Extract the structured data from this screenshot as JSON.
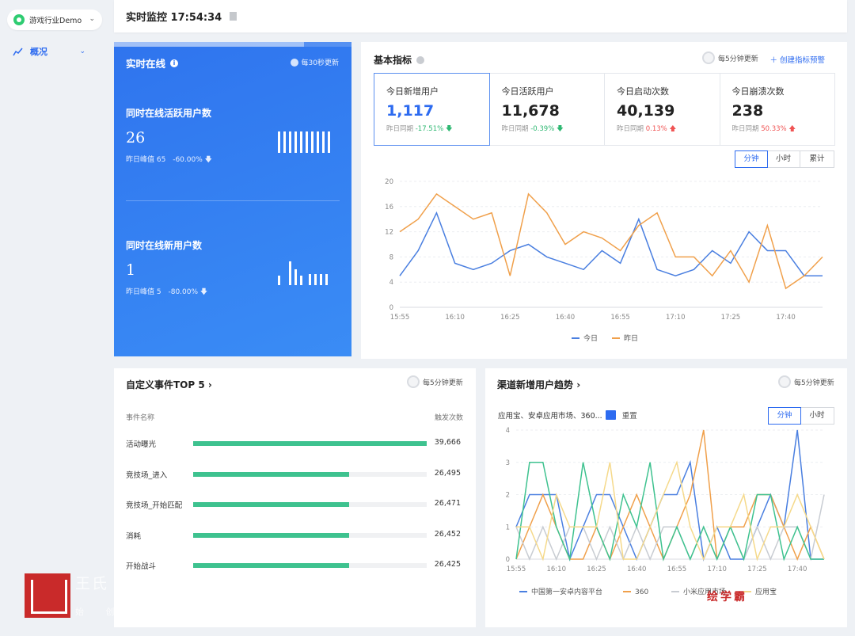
{
  "sidebar": {
    "app_name": "游戏行业Demo",
    "nav": [
      {
        "label": "概况"
      }
    ]
  },
  "topbar": {
    "title": "实时监控 17:54:34"
  },
  "online_panel": {
    "title": "实时在线",
    "refresh": "每30秒更新",
    "progress_fraction": 0.8,
    "active": {
      "label": "同时在线活跃用户数",
      "value": "26",
      "peak": "昨日峰值 65",
      "change": "-60.00%"
    },
    "new": {
      "label": "同时在线新用户数",
      "value": "1",
      "peak": "昨日峰值 5",
      "change": "-80.00%"
    }
  },
  "basic_metrics": {
    "title": "基本指标",
    "refresh": "每5分钟更新",
    "create_alert": "创建指标预警",
    "compare_label": "昨日同期",
    "kpis": [
      {
        "name": "今日新增用户",
        "value": "1,117",
        "change": "-17.51%",
        "dir": "down"
      },
      {
        "name": "今日活跃用户",
        "value": "11,678",
        "change": "-0.39%",
        "dir": "down"
      },
      {
        "name": "今日启动次数",
        "value": "40,139",
        "change": "0.13%",
        "dir": "up"
      },
      {
        "name": "今日崩溃次数",
        "value": "238",
        "change": "50.33%",
        "dir": "up"
      }
    ],
    "granularity": [
      "分钟",
      "小时",
      "累计"
    ],
    "granularity_selected": 0
  },
  "top_events": {
    "title": "自定义事件TOP 5",
    "refresh": "每5分钟更新",
    "col_name": "事件名称",
    "col_count": "触发次数",
    "max": 39666,
    "rows": [
      {
        "name": "活动曝光",
        "count": "39,666",
        "value": 39666
      },
      {
        "name": "竞技场_进入",
        "count": "26,495",
        "value": 26495
      },
      {
        "name": "竞技场_开始匹配",
        "count": "26,471",
        "value": 26471
      },
      {
        "name": "消耗",
        "count": "26,452",
        "value": 26452
      },
      {
        "name": "开始战斗",
        "count": "26,425",
        "value": 26425
      }
    ]
  },
  "channel_trend": {
    "title": "渠道新增用户趋势",
    "refresh": "每5分钟更新",
    "selector": "应用宝、安卓应用市场、360...",
    "reset": "重置",
    "granularity": [
      "分钟",
      "小时"
    ],
    "granularity_selected": 0
  },
  "watermark": {
    "text1": "王氏",
    "text2": "始 创",
    "text3": "绘学霸"
  },
  "chart_data": [
    {
      "type": "line",
      "x": [
        "15:55",
        "16:00",
        "16:05",
        "16:10",
        "16:15",
        "16:20",
        "16:25",
        "16:30",
        "16:35",
        "16:40",
        "16:45",
        "16:50",
        "16:55",
        "17:00",
        "17:05",
        "17:10",
        "17:15",
        "17:20",
        "17:25",
        "17:30",
        "17:35",
        "17:40",
        "17:45",
        "17:50"
      ],
      "x_ticks": [
        "15:55",
        "16:10",
        "16:25",
        "16:40",
        "16:55",
        "17:10",
        "17:25",
        "17:40"
      ],
      "ylim": [
        0,
        20
      ],
      "y_ticks": [
        0,
        4,
        8,
        12,
        16,
        20
      ],
      "grid": true,
      "legend": "bottom",
      "series": [
        {
          "name": "今日",
          "color": "#4a7fe0",
          "values": [
            5,
            9,
            15,
            7,
            6,
            7,
            9,
            10,
            8,
            7,
            6,
            9,
            7,
            14,
            6,
            5,
            6,
            9,
            7,
            12,
            9,
            9,
            5,
            5
          ]
        },
        {
          "name": "昨日",
          "color": "#f0a04b",
          "values": [
            12,
            14,
            18,
            16,
            14,
            15,
            5,
            18,
            15,
            10,
            12,
            11,
            9,
            13,
            15,
            8,
            8,
            5,
            9,
            4,
            13,
            3,
            5,
            8
          ]
        }
      ]
    },
    {
      "type": "line",
      "x": [
        "15:55",
        "16:00",
        "16:05",
        "16:10",
        "16:15",
        "16:20",
        "16:25",
        "16:30",
        "16:35",
        "16:40",
        "16:45",
        "16:50",
        "16:55",
        "17:00",
        "17:05",
        "17:10",
        "17:15",
        "17:20",
        "17:25",
        "17:30",
        "17:35",
        "17:40",
        "17:45",
        "17:50"
      ],
      "x_ticks": [
        "15:55",
        "16:10",
        "16:25",
        "16:40",
        "16:55",
        "17:10",
        "17:25",
        "17:40"
      ],
      "ylim": [
        0,
        4
      ],
      "y_ticks": [
        0,
        1,
        2,
        3,
        4
      ],
      "grid": true,
      "legend": "bottom",
      "series": [
        {
          "name": "中国第一安卓内容平台",
          "color": "#4a7fe0",
          "values": [
            1,
            2,
            2,
            2,
            0,
            1,
            2,
            2,
            1,
            0,
            1,
            2,
            2,
            3,
            0,
            1,
            0,
            0,
            1,
            2,
            1,
            4,
            0,
            0
          ]
        },
        {
          "name": "360",
          "color": "#f0a04b",
          "values": [
            0,
            1,
            2,
            1,
            0,
            0,
            1,
            0,
            1,
            2,
            1,
            0,
            1,
            2,
            4,
            0,
            1,
            1,
            2,
            2,
            1,
            0,
            1,
            0
          ]
        },
        {
          "name": "小米应用市场",
          "color": "#c8ccd2",
          "values": [
            1,
            0,
            1,
            0,
            1,
            1,
            0,
            1,
            0,
            1,
            0,
            1,
            1,
            0,
            1,
            0,
            1,
            0,
            1,
            0,
            1,
            1,
            0,
            2
          ]
        },
        {
          "name": "",
          "color": "#3ec28f",
          "values": [
            0,
            3,
            3,
            1,
            0,
            3,
            1,
            0,
            2,
            1,
            3,
            0,
            1,
            0,
            1,
            0,
            1,
            0,
            2,
            2,
            0,
            1,
            0,
            0
          ]
        },
        {
          "name": "应用宝",
          "color": "#f5d98a",
          "values": [
            1,
            1,
            0,
            2,
            1,
            1,
            1,
            3,
            0,
            0,
            1,
            2,
            3,
            1,
            0,
            1,
            1,
            2,
            0,
            1,
            1,
            2,
            1,
            0
          ]
        }
      ]
    }
  ]
}
